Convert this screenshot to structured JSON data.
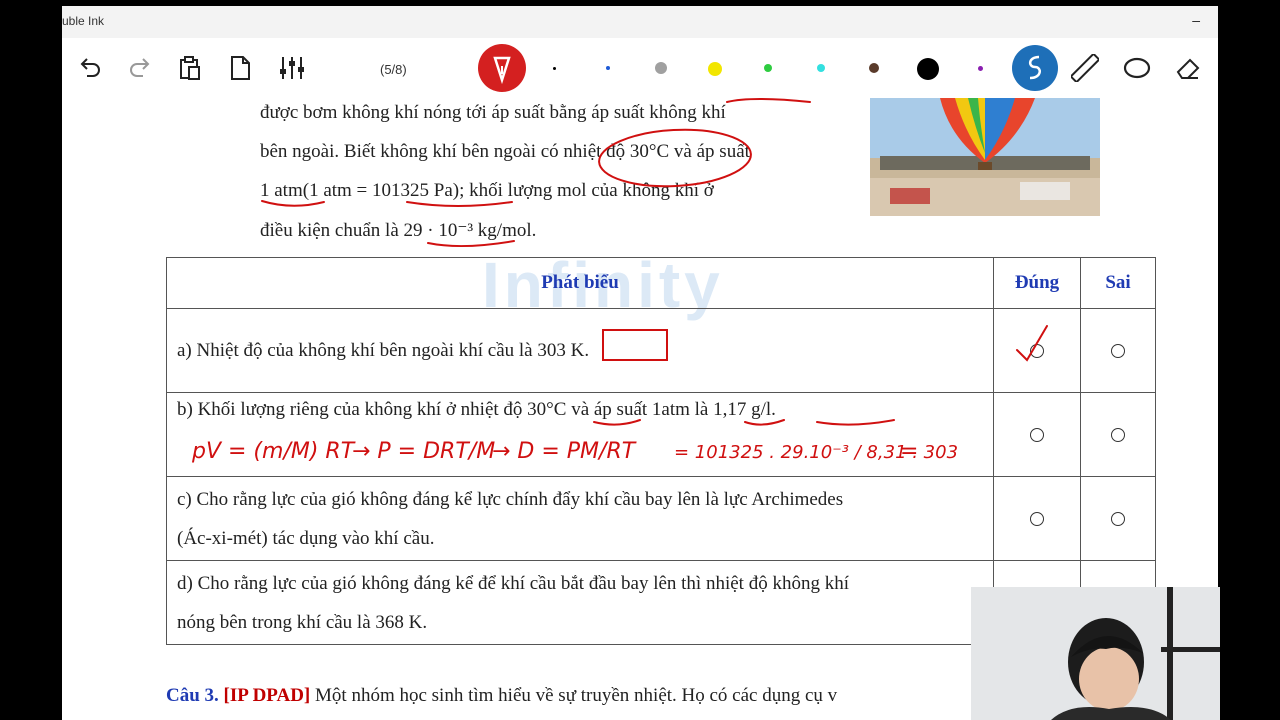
{
  "app": {
    "title": "uble Ink",
    "minimize": "–"
  },
  "toolbar": {
    "page_counter": "(5/8)",
    "pen_colors": [
      "#000000",
      "#1e5bd6",
      "#a0a0a0",
      "#f2e600",
      "#2ecc40",
      "#33e0e0",
      "#5a3b2b",
      "#000000",
      "#8a1eb0"
    ],
    "accent": "#d42020",
    "highlight": "#1e6fb8"
  },
  "doc": {
    "para_lines": [
      "được bơm không khí nóng tới áp suất bằng áp suất không khí",
      "bên ngoài. Biết không khí bên ngoài có nhiệt độ 30°C và áp suất",
      "1 atm(1 atm = 101325 Pa); khối lượng mol của không khí ở",
      "điều kiện chuẩn là 29 · 10⁻³ kg/mol."
    ],
    "watermark": "Infinity",
    "table": {
      "headers": {
        "statement": "Phát biểu",
        "true": "Đúng",
        "false": "Sai"
      },
      "rows": [
        {
          "text": "a) Nhiệt độ của không khí bên ngoài khí cầu là 303 K."
        },
        {
          "text": "b) Khối lượng riêng của không khí ở nhiệt độ 30°C và áp suất 1atm là 1,17 g/l."
        },
        {
          "text_1": "c) Cho rằng lực của gió không đáng kể lực chính đẩy khí cầu bay lên là lực Archimedes",
          "text_2": "(Ác-xi-mét) tác dụng vào khí cầu."
        },
        {
          "text_1": "d) Cho rằng lực của gió không đáng kể để khí cầu bắt đầu bay lên thì nhiệt độ không khí",
          "text_2": "nóng bên trong khí cầu là 368 K."
        }
      ]
    },
    "handwriting": {
      "formula_parts": [
        "pV = (m/M) RT",
        "→ P = DRT/M",
        "→ D = PM/RT",
        "= 101325 . 29.10⁻³ / 8,31 . 303",
        "="
      ]
    },
    "next_question": {
      "label": "Câu 3.",
      "tag": "[IP DPAD]",
      "text": "Một nhóm học sinh tìm hiểu về sự truyền nhiệt. Họ có các dụng cụ v"
    }
  }
}
